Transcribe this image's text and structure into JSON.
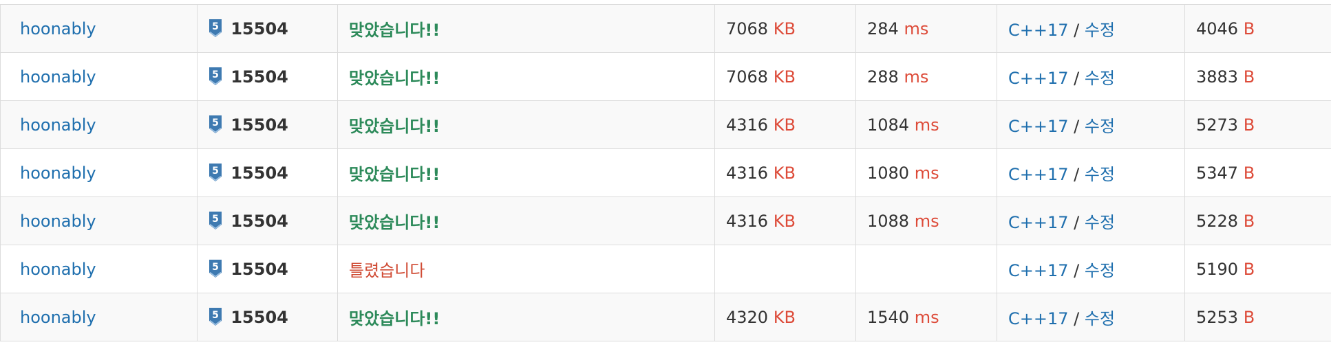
{
  "rows": [
    {
      "user": "hoonably",
      "tier_badge": "5",
      "problem": "15504",
      "result": "맞았습니다!!",
      "result_type": "accepted",
      "memory": "7068",
      "memory_unit": "KB",
      "time": "284",
      "time_unit": "ms",
      "language": "C++17",
      "separator": "/",
      "edit": "수정",
      "code_length": "4046",
      "code_unit": "B"
    },
    {
      "user": "hoonably",
      "tier_badge": "5",
      "problem": "15504",
      "result": "맞았습니다!!",
      "result_type": "accepted",
      "memory": "7068",
      "memory_unit": "KB",
      "time": "288",
      "time_unit": "ms",
      "language": "C++17",
      "separator": "/",
      "edit": "수정",
      "code_length": "3883",
      "code_unit": "B"
    },
    {
      "user": "hoonably",
      "tier_badge": "5",
      "problem": "15504",
      "result": "맞았습니다!!",
      "result_type": "accepted",
      "memory": "4316",
      "memory_unit": "KB",
      "time": "1084",
      "time_unit": "ms",
      "language": "C++17",
      "separator": "/",
      "edit": "수정",
      "code_length": "5273",
      "code_unit": "B"
    },
    {
      "user": "hoonably",
      "tier_badge": "5",
      "problem": "15504",
      "result": "맞았습니다!!",
      "result_type": "accepted",
      "memory": "4316",
      "memory_unit": "KB",
      "time": "1080",
      "time_unit": "ms",
      "language": "C++17",
      "separator": "/",
      "edit": "수정",
      "code_length": "5347",
      "code_unit": "B"
    },
    {
      "user": "hoonably",
      "tier_badge": "5",
      "problem": "15504",
      "result": "맞았습니다!!",
      "result_type": "accepted",
      "memory": "4316",
      "memory_unit": "KB",
      "time": "1088",
      "time_unit": "ms",
      "language": "C++17",
      "separator": "/",
      "edit": "수정",
      "code_length": "5228",
      "code_unit": "B"
    },
    {
      "user": "hoonably",
      "tier_badge": "5",
      "problem": "15504",
      "result": "틀렸습니다",
      "result_type": "wrong",
      "memory": "",
      "memory_unit": "",
      "time": "",
      "time_unit": "",
      "language": "C++17",
      "separator": "/",
      "edit": "수정",
      "code_length": "5190",
      "code_unit": "B"
    },
    {
      "user": "hoonably",
      "tier_badge": "5",
      "problem": "15504",
      "result": "맞았습니다!!",
      "result_type": "accepted",
      "memory": "4320",
      "memory_unit": "KB",
      "time": "1540",
      "time_unit": "ms",
      "language": "C++17",
      "separator": "/",
      "edit": "수정",
      "code_length": "5253",
      "code_unit": "B"
    }
  ],
  "colors": {
    "link": "#1f6fae",
    "accepted": "#2d8a5a",
    "wrong": "#d04b34",
    "unit": "#dd4b39",
    "tier_badge": "#3e7ab1",
    "row_alt": "#f9f9f9",
    "border": "#dcdcdc"
  },
  "icons": {
    "tier": "tier-badge-icon"
  }
}
